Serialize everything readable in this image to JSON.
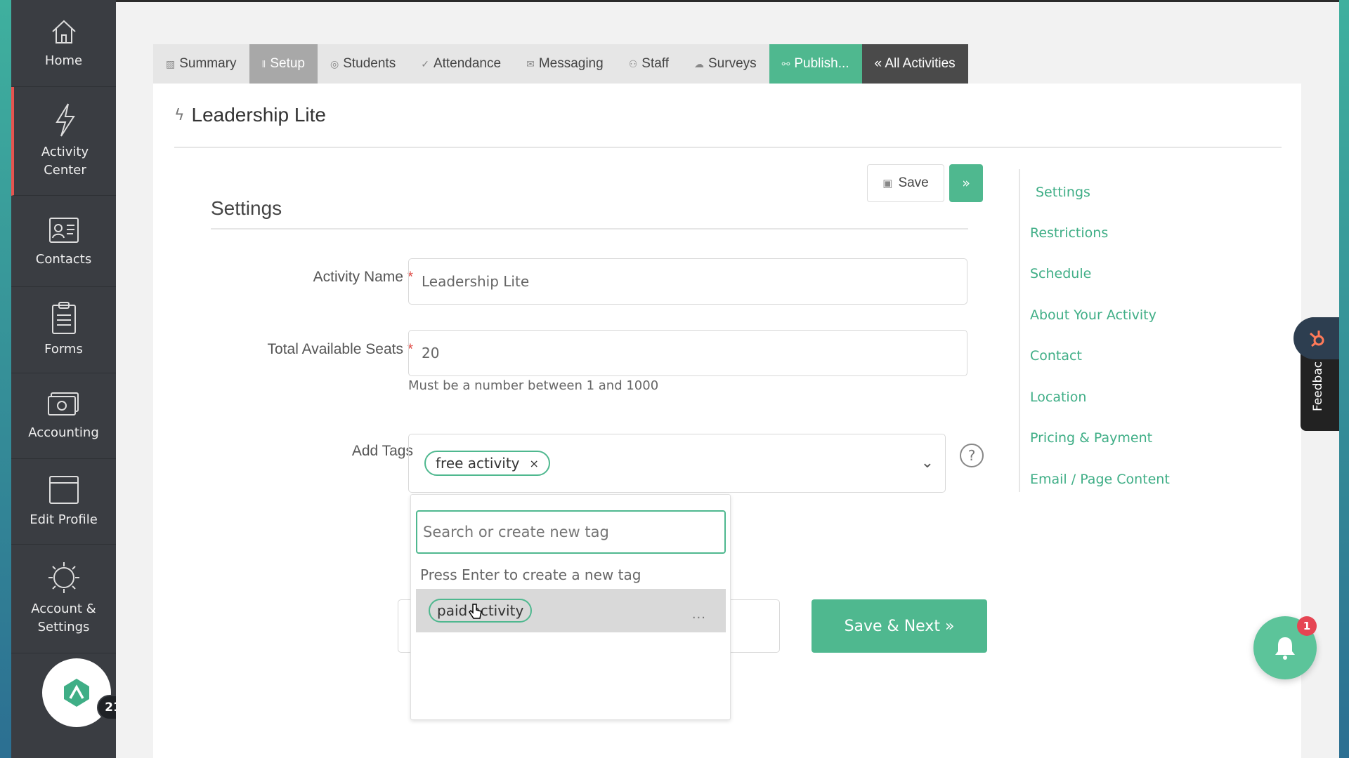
{
  "sidebar": {
    "items": [
      {
        "label": "Home",
        "icon": "home-icon"
      },
      {
        "label": "Activity\nCenter",
        "icon": "bolt-icon"
      },
      {
        "label": "Contacts",
        "icon": "contacts-card-icon"
      },
      {
        "label": "Forms",
        "icon": "clipboard-icon"
      },
      {
        "label": "Accounting",
        "icon": "money-icon"
      },
      {
        "label": "Edit Profile",
        "icon": "browser-window-icon"
      },
      {
        "label": "Account &\nSettings",
        "icon": "gear-icon"
      }
    ],
    "badge_count": "21"
  },
  "tabs": {
    "summary": "Summary",
    "setup": "Setup",
    "students": "Students",
    "attendance": "Attendance",
    "messaging": "Messaging",
    "staff": "Staff",
    "surveys": "Surveys",
    "publish": "Publish...",
    "all_activities": "« All Activities"
  },
  "page_title": "Leadership Lite",
  "settings": {
    "title": "Settings",
    "save_label": "Save",
    "next_label": "»"
  },
  "form": {
    "activity_name_label": "Activity Name",
    "activity_name_value": "Leadership Lite",
    "seats_label": "Total Available Seats",
    "seats_value": "20",
    "seats_help": "Must be a number between 1 and 1000",
    "tags_label": "Add Tags",
    "selected_tags": [
      "free activity"
    ],
    "required_mark": "*"
  },
  "tag_dropdown": {
    "search_placeholder": "Search or create new tag",
    "hint": "Press Enter to create a new tag",
    "options": [
      "paid activity"
    ],
    "more": "..."
  },
  "save_next_label": "Save & Next »",
  "right_nav": [
    "Settings",
    "Restrictions",
    "Schedule",
    "About Your Activity",
    "Contact",
    "Location",
    "Pricing & Payment",
    "Email / Page Content"
  ],
  "feedback_label": "Feedbac",
  "notifications": {
    "count": "1"
  },
  "colors": {
    "accent": "#4fb88f",
    "sidebar": "#3a3d42",
    "required": "#e0504b",
    "badge": "#e64553"
  }
}
